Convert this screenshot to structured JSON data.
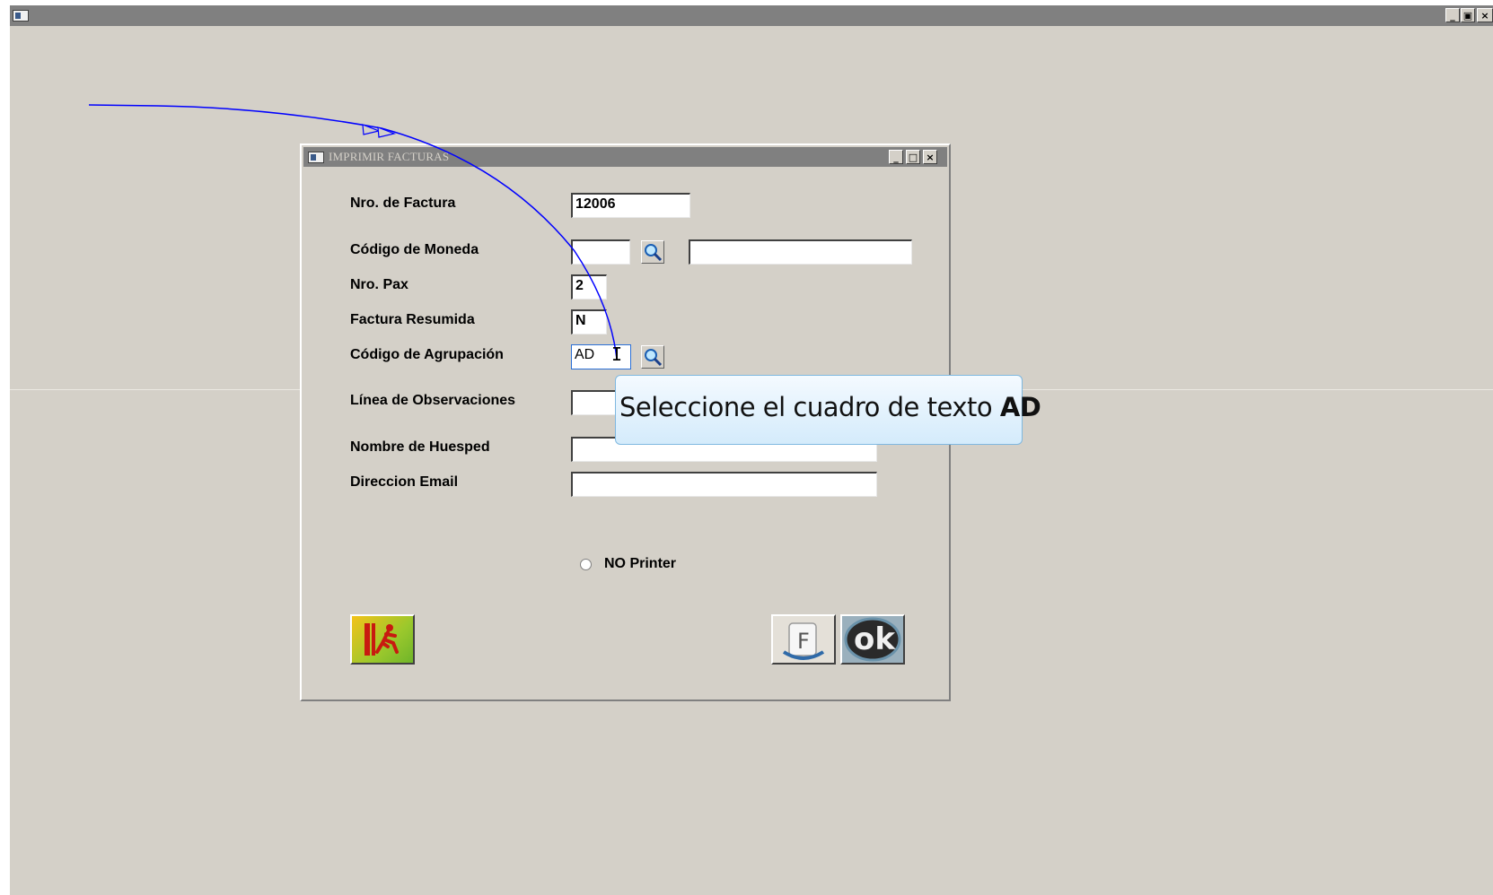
{
  "dialog": {
    "title": "IMPRIMIR FACTURAS"
  },
  "form": {
    "nro_factura": {
      "label": "Nro. de Factura",
      "value": "12006"
    },
    "codigo_moneda": {
      "label": "Código de Moneda",
      "value": "",
      "description": ""
    },
    "nro_pax": {
      "label": "Nro. Pax",
      "value": "2"
    },
    "factura_resumida": {
      "label": "Factura Resumida",
      "value": "N"
    },
    "codigo_agrupacion": {
      "label": "Código de Agrupación",
      "value": "AD"
    },
    "linea_observaciones": {
      "label": "Línea de Observaciones",
      "value": ""
    },
    "nombre_huesped": {
      "label": "Nombre de Huesped",
      "value": ""
    },
    "direccion_email": {
      "label": "Direccion Email",
      "value": ""
    }
  },
  "printer_option": {
    "label": "NO Printer",
    "selected": false
  },
  "buttons": {
    "exit_icon": "exit-running-man-icon",
    "f_label": "F",
    "ok_label": "ok"
  },
  "tooltip": {
    "text": "Seleccione el cuadro de texto ",
    "target": "AD"
  },
  "colors": {
    "window_bg": "#d4d0c8",
    "titlebar": "#808080",
    "annotation_arrow": "#0000ff",
    "tooltip_border": "#7fb8e0",
    "focus_border": "#2a6fd6"
  }
}
